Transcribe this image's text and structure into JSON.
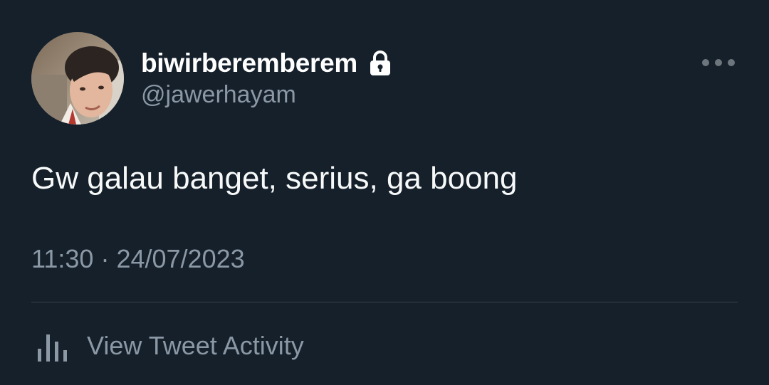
{
  "tweet": {
    "display_name": "biwirberemberem",
    "handle": "@jawerhayam",
    "text": "Gw galau banget, serius, ga boong",
    "time": "11:30",
    "separator": "·",
    "date": "24/07/2023",
    "activity_label": "View Tweet Activity",
    "protected_icon": "lock-icon",
    "more_icon": "more-horizontal-icon",
    "activity_icon": "bar-chart-icon"
  },
  "colors": {
    "background": "#15202b",
    "primary_text": "#f7f9f9",
    "secondary_text": "#8b98a5",
    "divider": "#38444d"
  }
}
